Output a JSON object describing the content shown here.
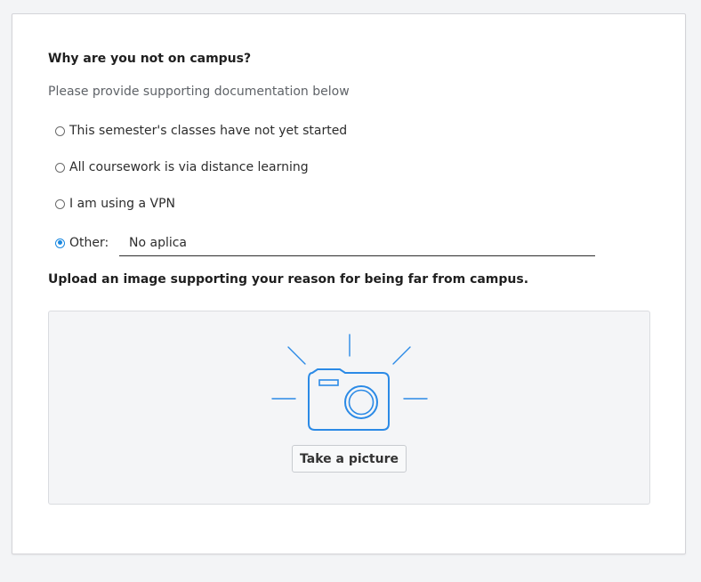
{
  "question": {
    "title": "Why are you not on campus?",
    "hint": "Please provide supporting documentation below",
    "options": [
      {
        "label": "This semester's classes have not yet started",
        "selected": false
      },
      {
        "label": "All coursework is via distance learning",
        "selected": false
      },
      {
        "label": "I am using a VPN",
        "selected": false
      },
      {
        "label": "Other:",
        "selected": true
      }
    ],
    "other_value": "No aplica"
  },
  "upload": {
    "title": "Upload an image supporting your reason for being far from campus.",
    "icon": "camera-icon",
    "button_label": "Take a picture"
  },
  "colors": {
    "accent": "#1a88e0",
    "icon_stroke": "#2b8ae6"
  }
}
